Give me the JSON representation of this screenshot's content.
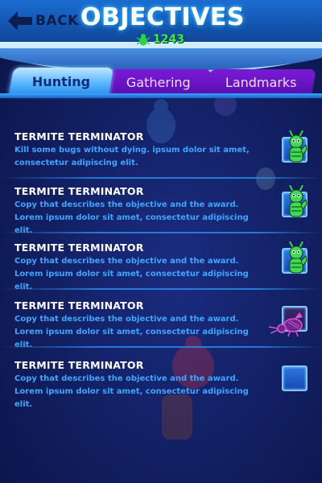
{
  "header": {
    "back_label": "BACK",
    "title": "OBJECTIVES",
    "score": "1243"
  },
  "tabs": [
    {
      "label": "Hunting",
      "active": true
    },
    {
      "label": "Gathering",
      "active": false
    },
    {
      "label": "Landmarks",
      "active": false
    }
  ],
  "objectives": [
    {
      "title": "TERMITE TERMINATOR",
      "description": "Kill some bugs without dying. ipsum dolor sit amet, consectetur adipiscing elit.",
      "status": "completed"
    },
    {
      "title": "TERMITE TERMINATOR",
      "description": "Copy that describes the objective and the award. Lorem ipsum dolor sit amet, consectetur adipiscing elit.",
      "status": "completed"
    },
    {
      "title": "TERMITE TERMINATOR",
      "description": "Copy that describes the objective and the award. Lorem ipsum dolor sit amet, consectetur adipiscing elit.",
      "status": "completed"
    },
    {
      "title": "TERMITE TERMINATOR",
      "description": "Copy that describes the objective and the award. Lorem ipsum dolor sit amet, consectetur adipiscing elit.",
      "status": "failed"
    },
    {
      "title": "TERMITE TERMINATOR",
      "description": "Copy that describes the objective and the award. Lorem ipsum dolor sit amet, consectetur adipiscing elit.",
      "status": "incomplete"
    }
  ],
  "colors": {
    "accent_blue": "#3fa6ff",
    "score_green": "#43e85a",
    "tab_purple": "#6a15c4",
    "active_tab": "#55b3ff"
  }
}
